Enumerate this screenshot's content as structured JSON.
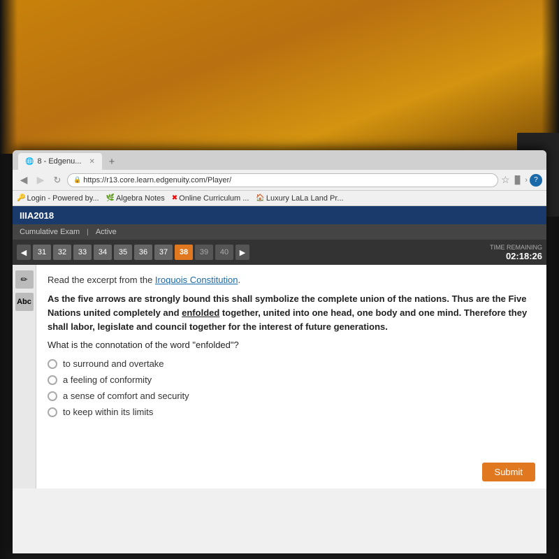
{
  "background": {
    "color": "#1a1a1a"
  },
  "browser": {
    "tab_label": "8 - Edgenu...",
    "new_tab_symbol": "+",
    "url": "https://r13.core.learn.edgenuity.com/Player/",
    "bookmarks": [
      {
        "label": "Login - Powered by...",
        "icon": "🔑"
      },
      {
        "label": "Algebra Notes",
        "icon": "🌿"
      },
      {
        "label": "Online Curriculum ...",
        "icon": "✖"
      },
      {
        "label": "Luxury LaLa Land Pr...",
        "icon": "🏠"
      }
    ]
  },
  "app": {
    "title": "IIIA2018",
    "exam_label": "Cumulative Exam",
    "status_label": "Active"
  },
  "toolbar": {
    "questions": [
      31,
      32,
      33,
      34,
      35,
      36,
      37,
      38,
      39,
      40
    ],
    "active_question": 38,
    "time_remaining_label": "TIME REMAINING",
    "time_remaining_value": "02:18:26"
  },
  "question": {
    "intro": "Read the excerpt from the Iroquois Constitution.",
    "passage": "As the five arrows are strongly bound this shall symbolize the complete union of the nations. Thus are the Five Nations united completely and enfolded together, united into one head, one body and one mind. Therefore they shall labor, legislate and council together for the interest of future generations.",
    "question_text": "What is the connotation of the word \"enfolded\"?",
    "options": [
      "to surround and overtake",
      "a feeling of conformity",
      "a sense of comfort and security",
      "to keep within its limits"
    ],
    "submit_label": "Submit"
  },
  "icons": {
    "lock": "🔒",
    "star": "☆",
    "arrow_left": "◀",
    "arrow_right": "▶",
    "pen": "✏",
    "abc": "Abc"
  }
}
